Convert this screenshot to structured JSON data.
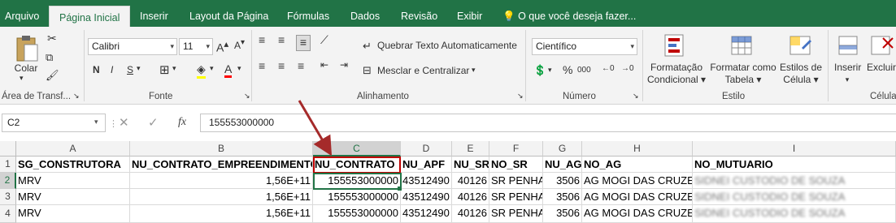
{
  "tabs": [
    "Arquivo",
    "Página Inicial",
    "Inserir",
    "Layout da Página",
    "Fórmulas",
    "Dados",
    "Revisão",
    "Exibir",
    "O que você deseja fazer..."
  ],
  "clipboard": {
    "paste_label": "Colar",
    "group": "Área de Transf..."
  },
  "font": {
    "name": "Calibri",
    "size": "11",
    "bold": "N",
    "italic": "I",
    "underline": "S",
    "group": "Fonte"
  },
  "alignment": {
    "wrap": "Quebrar Texto Automaticamente",
    "merge": "Mesclar e Centralizar",
    "group": "Alinhamento"
  },
  "number": {
    "format": "Científico",
    "group": "Número"
  },
  "styles": {
    "conditional": [
      "Formatação",
      "Condicional"
    ],
    "as_table": [
      "Formatar como",
      "Tabela"
    ],
    "cell_styles": [
      "Estilos de",
      "Célula"
    ],
    "group": "Estilo"
  },
  "cells_group": {
    "insert": "Inserir",
    "delete": "Excluir",
    "group": "Célula"
  },
  "formula_bar": {
    "name_box": "C2",
    "formula": "155553000000",
    "fx": "fx"
  },
  "columns": [
    "A",
    "B",
    "C",
    "D",
    "E",
    "F",
    "G",
    "H",
    "I"
  ],
  "rows": [
    "1",
    "2",
    "3",
    "4"
  ],
  "header_row": [
    "SG_CONSTRUTORA",
    "NU_CONTRATO_EMPREENDIMENTO",
    "NU_CONTRATO",
    "NU_APF",
    "NU_SR",
    "NO_SR",
    "NU_AG",
    "NO_AG",
    "NO_MUTUARIO"
  ],
  "data_rows": [
    [
      "MRV",
      "1,56E+11",
      "155553000000",
      "43512490",
      "40126",
      "SR PENHA",
      "3506",
      "AG MOGI DAS CRUZES",
      "SIDNEI CUSTODIO DE SOUZA"
    ],
    [
      "MRV",
      "1,56E+11",
      "155553000000",
      "43512490",
      "40126",
      "SR PENHA",
      "3506",
      "AG MOGI DAS CRUZES",
      "SIDNEI CUSTODIO DE SOUZA"
    ],
    [
      "MRV",
      "1,56E+11",
      "155553000000",
      "43512490",
      "40126",
      "SR PENHA",
      "3506",
      "AG MOGI DAS CRUZES",
      "SIDNEI CUSTODIO DE SOUZA"
    ]
  ],
  "colors": {
    "excel_green": "#217346",
    "highlight": "#c00000",
    "arrow": "#a52a2a"
  }
}
